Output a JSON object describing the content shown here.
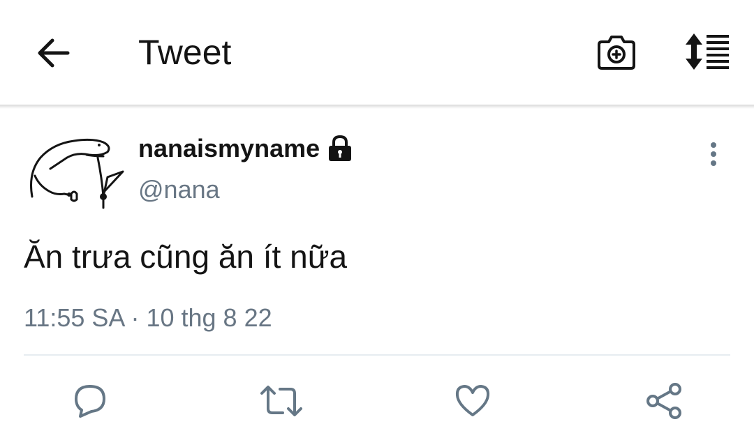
{
  "header": {
    "title": "Tweet",
    "back_icon": "arrow-left-icon",
    "camera_icon": "camera-add-icon",
    "sort_icon": "sort-list-icon"
  },
  "tweet": {
    "display_name": "nanaismyname",
    "lock_icon": "lock-icon",
    "handle": "@nana",
    "text": "Ăn trưa cũng ăn ít nữa",
    "timestamp": "11:55 SA · 10 thg 8 22"
  },
  "actions": {
    "reply_icon": "reply-icon",
    "retweet_icon": "retweet-icon",
    "like_icon": "heart-icon",
    "share_icon": "share-icon"
  },
  "colors": {
    "text_primary": "#141414",
    "text_secondary": "#687684",
    "icon_gray": "#657786",
    "divider": "#e6ecf0"
  }
}
